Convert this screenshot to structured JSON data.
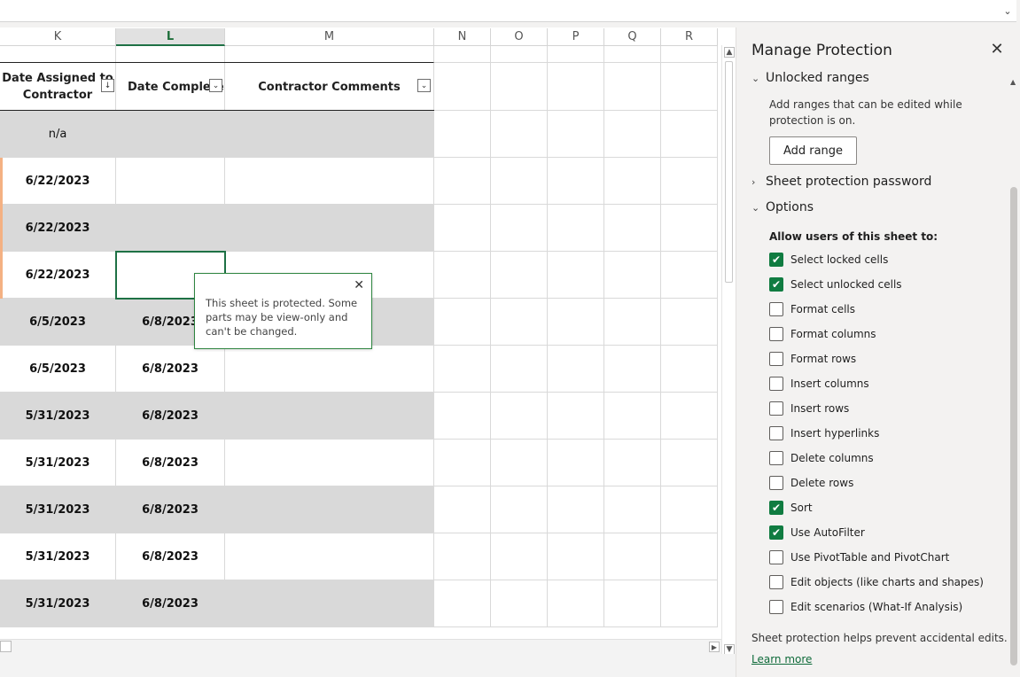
{
  "sheet": {
    "columns": [
      "K",
      "L",
      "M",
      "N",
      "O",
      "P",
      "Q",
      "R"
    ],
    "headers": {
      "k_line1": "Date Assigned to",
      "k_line2": "Contractor",
      "l": "Date Complete",
      "m": "Contractor Comments"
    },
    "filter_icons": {
      "k": "sort-filter-icon",
      "l": "filter-dropdown-icon",
      "m": "filter-dropdown-icon"
    },
    "rows": [
      {
        "k": "n/a",
        "l": "",
        "gray": true
      },
      {
        "k": "6/22/2023",
        "l": "",
        "gray": false
      },
      {
        "k": "6/22/2023",
        "l": "",
        "gray": true
      },
      {
        "k": "6/22/2023",
        "l": "",
        "gray": false
      },
      {
        "k": "6/5/2023",
        "l": "6/8/2023",
        "gray": true
      },
      {
        "k": "6/5/2023",
        "l": "6/8/2023",
        "gray": false
      },
      {
        "k": "5/31/2023",
        "l": "6/8/2023",
        "gray": true
      },
      {
        "k": "5/31/2023",
        "l": "6/8/2023",
        "gray": false
      },
      {
        "k": "5/31/2023",
        "l": "6/8/2023",
        "gray": true
      },
      {
        "k": "5/31/2023",
        "l": "6/8/2023",
        "gray": false
      },
      {
        "k": "5/31/2023",
        "l": "6/8/2023",
        "gray": true
      }
    ],
    "selected_column": "L"
  },
  "tooltip": {
    "text": "This sheet is protected. Some parts may be view-only and can't be changed.",
    "close_icon": "close-icon"
  },
  "pane": {
    "title": "Manage Protection",
    "sections": {
      "unlocked_ranges": "Unlocked ranges",
      "sheet_password": "Sheet protection password",
      "options": "Options"
    },
    "unlocked_desc": "Add ranges that can be edited while protection is on.",
    "add_range_label": "Add range",
    "allow_label": "Allow users of this sheet to:",
    "options": [
      {
        "label": "Select locked cells",
        "checked": true
      },
      {
        "label": "Select unlocked cells",
        "checked": true
      },
      {
        "label": "Format cells",
        "checked": false
      },
      {
        "label": "Format columns",
        "checked": false
      },
      {
        "label": "Format rows",
        "checked": false
      },
      {
        "label": "Insert columns",
        "checked": false
      },
      {
        "label": "Insert rows",
        "checked": false
      },
      {
        "label": "Insert hyperlinks",
        "checked": false
      },
      {
        "label": "Delete columns",
        "checked": false
      },
      {
        "label": "Delete rows",
        "checked": false
      },
      {
        "label": "Sort",
        "checked": true
      },
      {
        "label": "Use AutoFilter",
        "checked": true
      },
      {
        "label": "Use PivotTable and PivotChart",
        "checked": false
      },
      {
        "label": "Edit objects (like charts and shapes)",
        "checked": false
      },
      {
        "label": "Edit scenarios (What-If Analysis)",
        "checked": false
      }
    ],
    "footer": "Sheet protection helps prevent accidental edits.",
    "learn_more": "Learn more"
  },
  "colors": {
    "accent": "#107c41",
    "row_gray": "#d9d9d9",
    "row_marker": "#f4b183"
  }
}
